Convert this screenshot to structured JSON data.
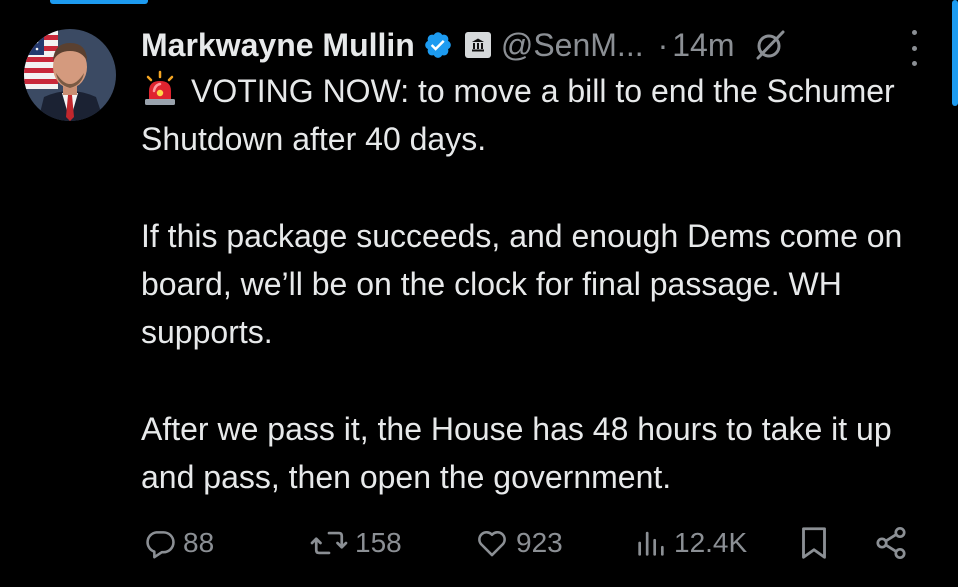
{
  "colors": {
    "background": "#000000",
    "text": "#e7e9ea",
    "secondary_text": "#8b8f94",
    "accent": "#1d9bf0",
    "verified_badge": "#1d9bf0"
  },
  "post": {
    "author": {
      "name": "Markwayne Mullin",
      "handle": "@SenM...",
      "verified_icon": "verified-badge-icon",
      "affiliation_icon": "government-building-icon",
      "avatar_icon": "profile-photo"
    },
    "separator": "·",
    "timestamp": "14m",
    "paragraphs": [
      "VOTING NOW: to move a bill to end the Schumer Shutdown after 40 days.",
      "If this package succeeds, and enough Dems come on board, we’ll be on the clock for final passage. WH supports.",
      "After we pass it, the House has 48 hours to take it up and pass, then open the government."
    ],
    "lead_emoji": "rotating-light-emoji",
    "actions": {
      "replies": "88",
      "reposts": "158",
      "likes": "923",
      "views": "12.4K"
    }
  }
}
